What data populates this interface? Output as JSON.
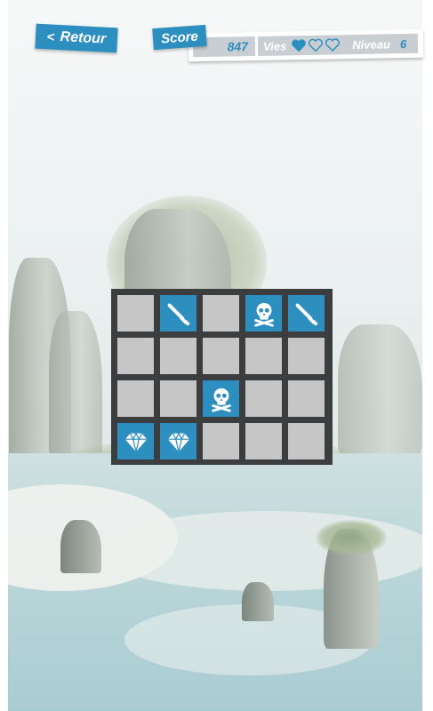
{
  "header": {
    "back_label": "Retour",
    "back_icon": "chevron-left-icon",
    "score_label": "Score",
    "score_value": "847",
    "lives_label": "Vies",
    "lives": {
      "filled": 1,
      "total": 3
    },
    "level_label": "Niveau",
    "level_value": "6"
  },
  "colors": {
    "accent": "#2d8fbf",
    "tile_empty": "#c6c6c6",
    "board": "#3b3d3f",
    "stats_bg": "#c9ced2"
  },
  "board": {
    "cols": 5,
    "rows": 4,
    "cells": [
      [
        "",
        "sword",
        "",
        "skull",
        "sword"
      ],
      [
        "",
        "",
        "",
        "",
        ""
      ],
      [
        "",
        "",
        "skull",
        "",
        ""
      ],
      [
        "diamond",
        "diamond",
        "",
        "",
        ""
      ]
    ]
  }
}
